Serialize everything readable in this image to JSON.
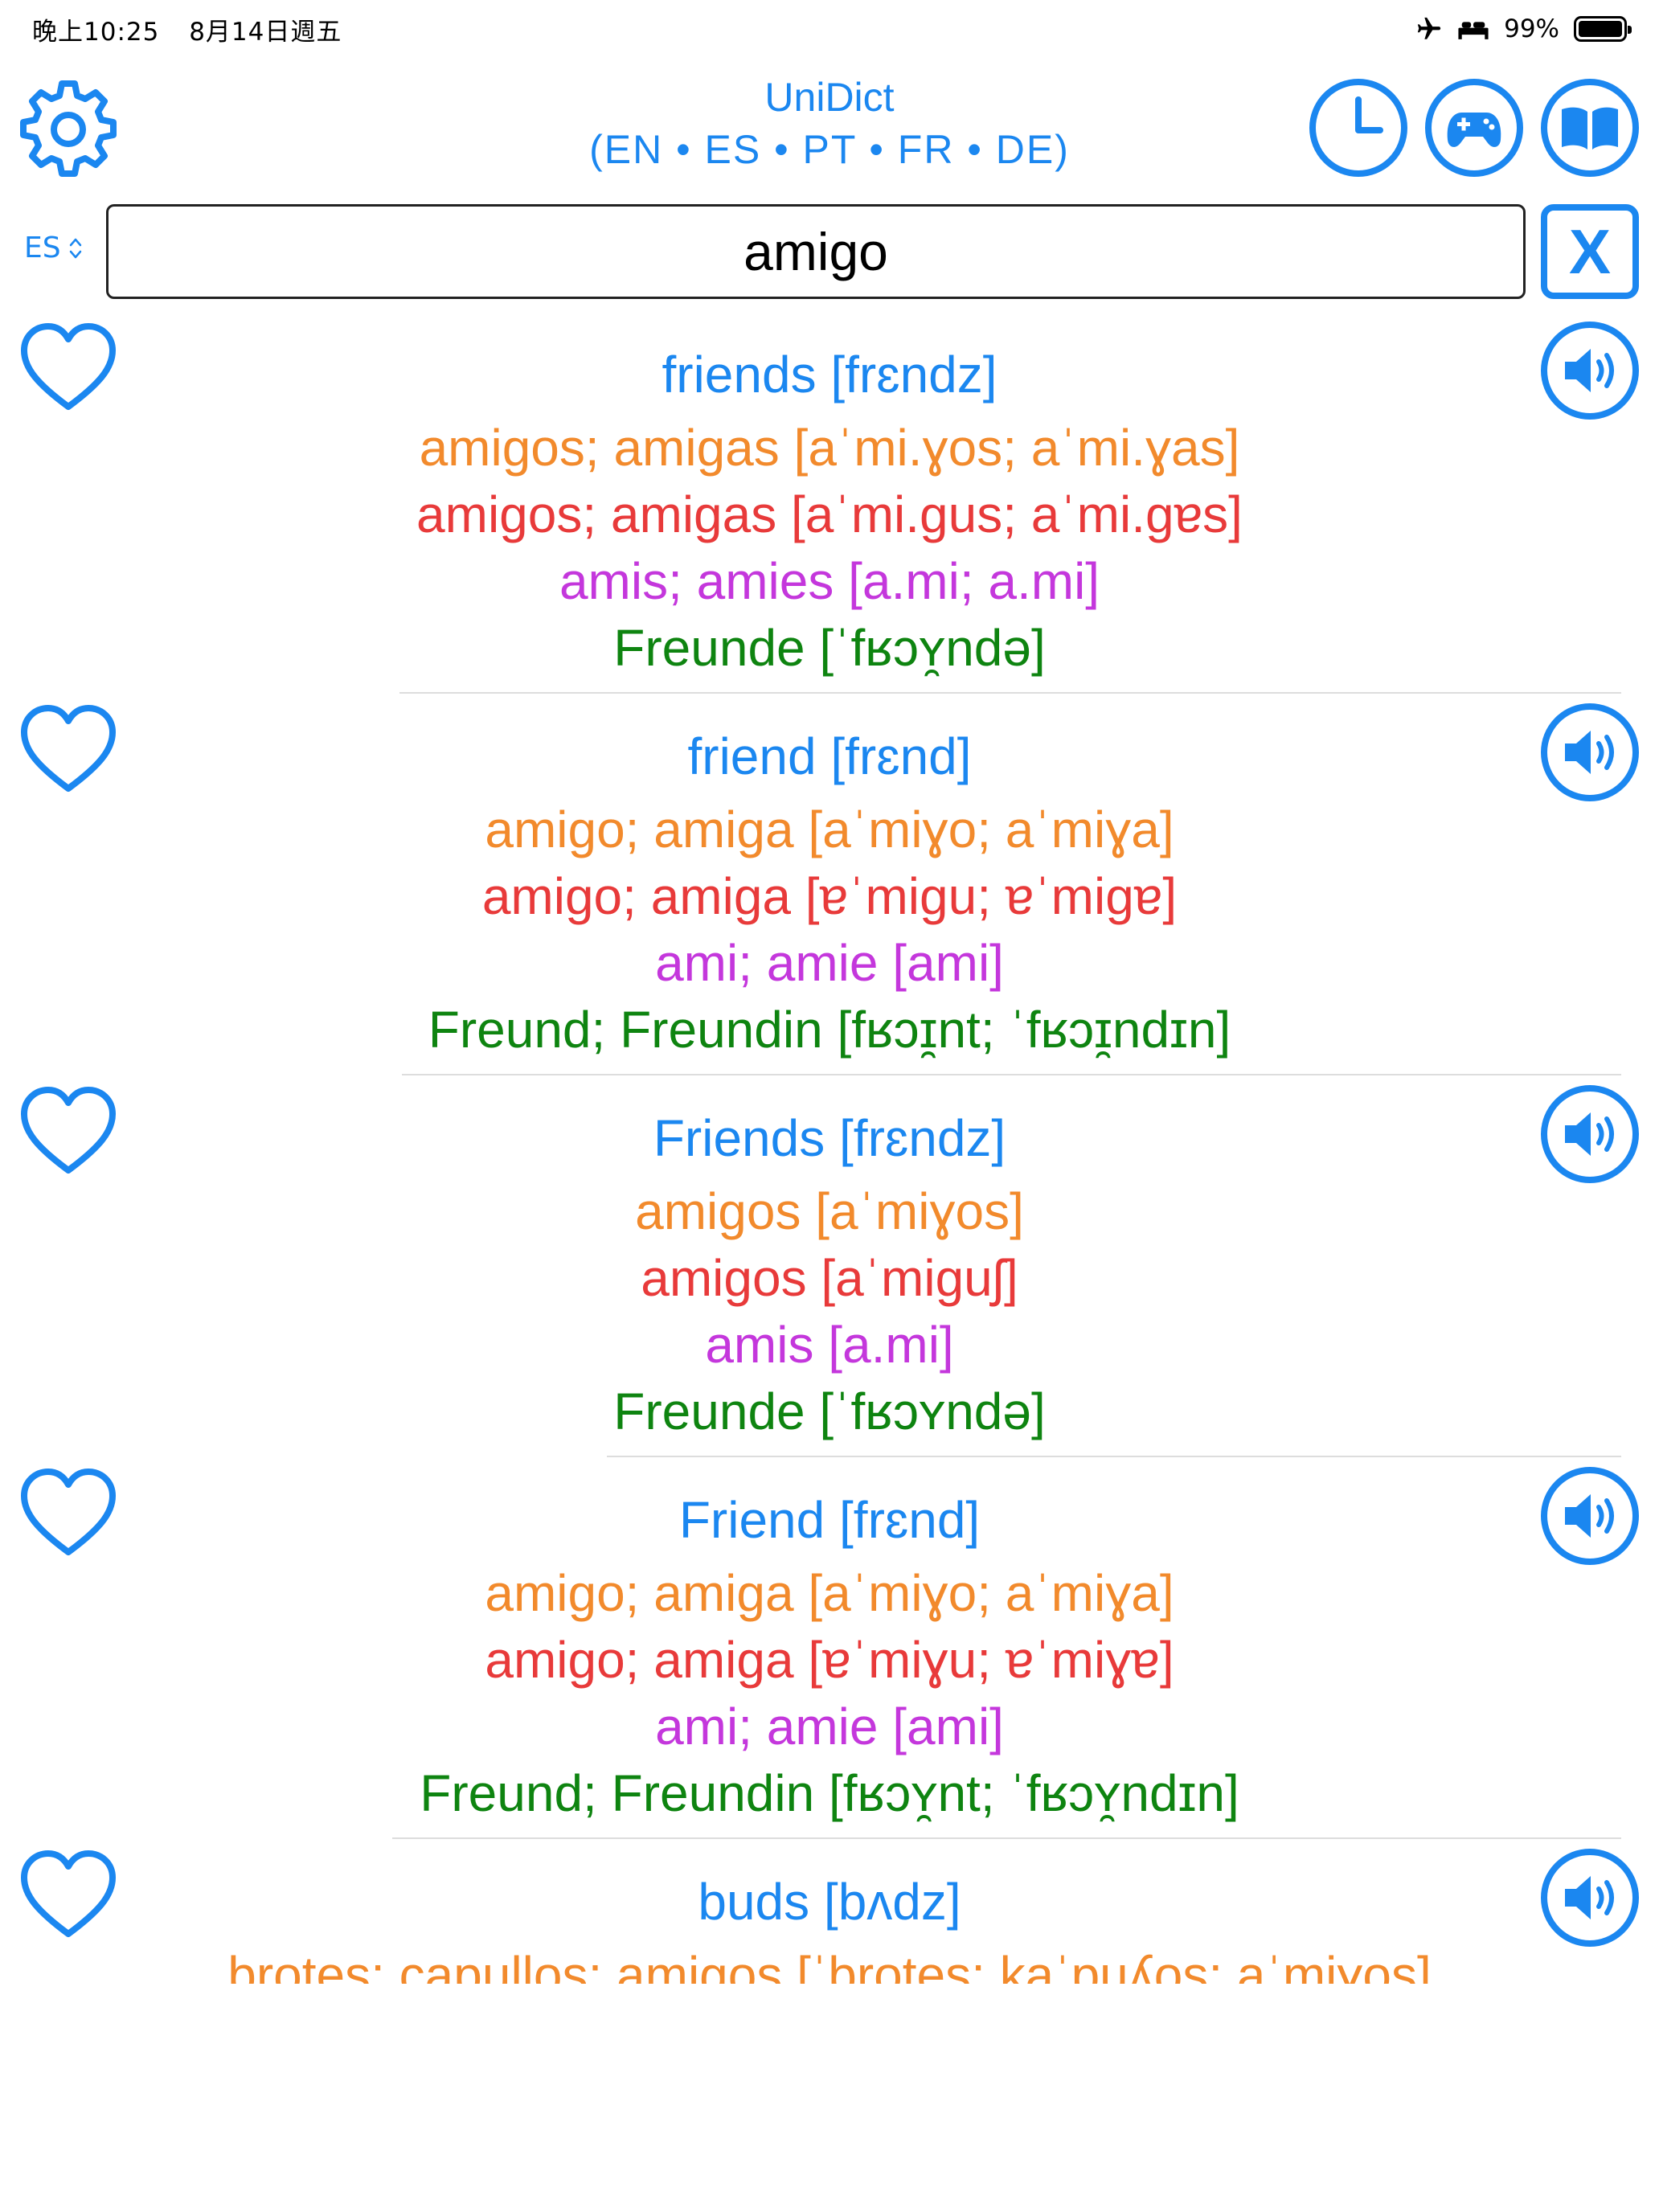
{
  "status_bar": {
    "time": "晚上10:25",
    "date": "8月14日週五",
    "battery": "99%"
  },
  "header": {
    "title": "UniDict",
    "languages": "(EN • ES • PT • FR • DE)"
  },
  "search": {
    "language": "ES",
    "value": "amigo",
    "clear_label": "X"
  },
  "colors": {
    "accent": "#1b87f0",
    "es": "#f28a2c",
    "pt": "#e83a3a",
    "fr": "#c437dc",
    "de": "#0e8410"
  },
  "results": [
    {
      "en": "friends [frɛndz]",
      "es": "amigos; amigas [aˈmi.ɣos; aˈmi.ɣas]",
      "pt": "amigos; amigas [aˈmi.gus; aˈmi.gɐs]",
      "fr": "amis; amies [a.mi; a.mi]",
      "de": "Freunde [ˈfʁɔʏ̯ndə]"
    },
    {
      "en": "friend [frɛnd]",
      "es": "amigo; amiga [aˈmiɣo; aˈmiɣa]",
      "pt": "amigo; amiga [ɐˈmigu; ɐˈmigɐ]",
      "fr": "ami; amie [ami]",
      "de": "Freund; Freundin [fʁɔɪ̯nt; ˈfʁɔɪ̯ndɪn]"
    },
    {
      "en": "Friends [frɛndz]",
      "es": "amigos [aˈmiɣos]",
      "pt": "amigos [aˈmiguʃ]",
      "fr": "amis [a.mi]",
      "de": "Freunde [ˈfʁɔʏndə]"
    },
    {
      "en": "Friend [frɛnd]",
      "es": "amigo; amiga [aˈmiɣo; aˈmiɣa]",
      "pt": "amigo; amiga [ɐˈmiɣu; ɐˈmiɣɐ]",
      "fr": "ami; amie [ami]",
      "de": "Freund; Freundin [fʁɔʏ̯nt; ˈfʁɔʏ̯ndɪn]"
    },
    {
      "en": "buds [bʌdz]",
      "es": "brotes; capullos; amigos [ˈbrotes; kaˈpuʎos; aˈmiɣos]",
      "pt": "",
      "fr": "",
      "de": ""
    }
  ]
}
